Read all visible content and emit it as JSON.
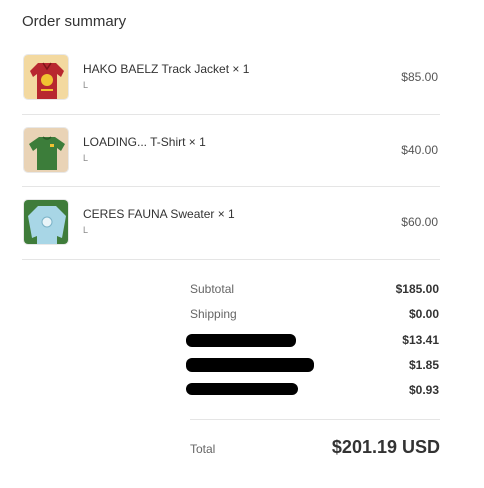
{
  "title": "Order summary",
  "items": [
    {
      "name": "HAKO BAELZ Track Jacket × 1",
      "variant": "L",
      "price": "$85.00",
      "thumb_color": "#b8272f",
      "thumb_bg": "#f3d9a0"
    },
    {
      "name": "LOADING... T-Shirt × 1",
      "variant": "L",
      "price": "$40.00",
      "thumb_color": "#3c7d3a",
      "thumb_bg": "#e9d3b6"
    },
    {
      "name": "CERES FAUNA Sweater × 1",
      "variant": "L",
      "price": "$60.00",
      "thumb_color": "#a8d6e6",
      "thumb_bg": "#3f7c3a"
    }
  ],
  "totals": [
    {
      "label": "Subtotal",
      "value": "$185.00",
      "redacted": false
    },
    {
      "label": "Shipping",
      "value": "$0.00",
      "redacted": false
    },
    {
      "label": "",
      "value": "$13.41",
      "redacted": true
    },
    {
      "label": "",
      "value": "$1.85",
      "redacted": true
    },
    {
      "label": "",
      "value": "$0.93",
      "redacted": true
    }
  ],
  "total": {
    "label": "Total",
    "amount": "$201.19 USD"
  }
}
